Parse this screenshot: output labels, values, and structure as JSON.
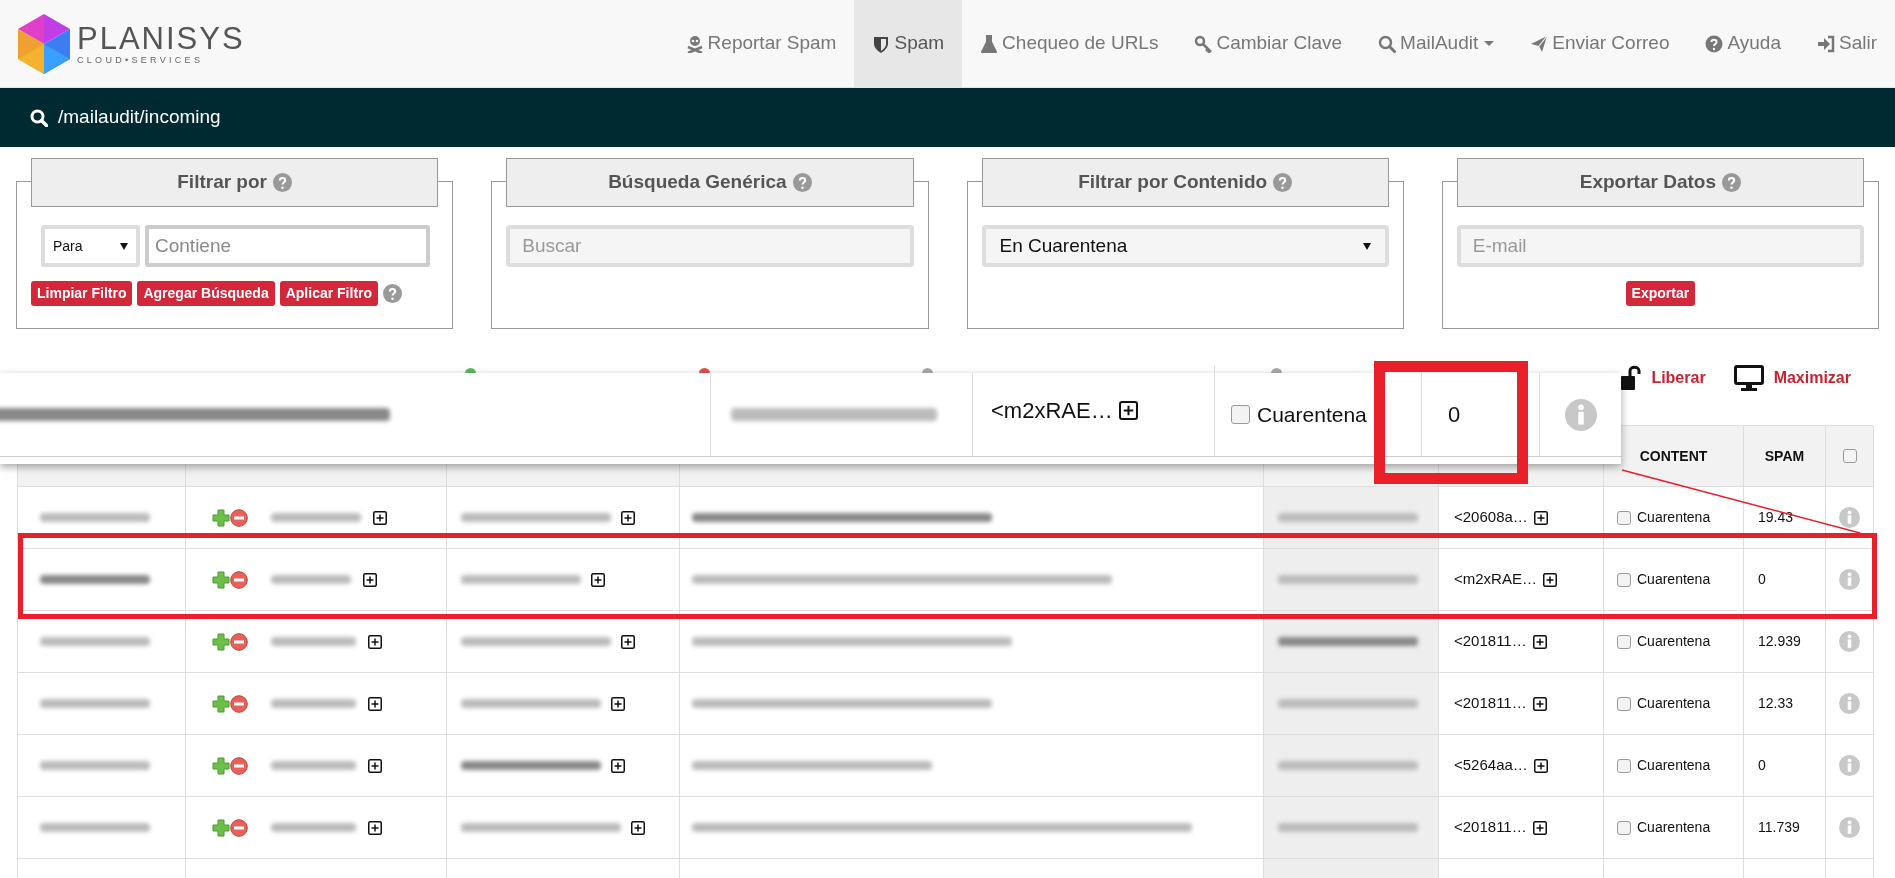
{
  "logo": {
    "name": "PLANISYS",
    "tagline": "CLOUD•SERVICES"
  },
  "nav": [
    {
      "kind": "skull",
      "label": "Reportar Spam",
      "selected": false,
      "dropdown": false
    },
    {
      "kind": "shield",
      "label": "Spam",
      "selected": true,
      "dropdown": false
    },
    {
      "kind": "flask",
      "label": "Chequeo de URLs",
      "selected": false,
      "dropdown": false
    },
    {
      "kind": "key",
      "label": "Cambiar Clave",
      "selected": false,
      "dropdown": false
    },
    {
      "kind": "search",
      "label": "MailAudit",
      "selected": false,
      "dropdown": true
    },
    {
      "kind": "send",
      "label": "Enviar Correo",
      "selected": false,
      "dropdown": false
    },
    {
      "kind": "help",
      "label": "Ayuda",
      "selected": false,
      "dropdown": false
    },
    {
      "kind": "signin",
      "label": "Salir",
      "selected": false,
      "dropdown": false
    }
  ],
  "path_bar": {
    "path": "/mailaudit/incoming"
  },
  "panels": [
    {
      "kind": "filter",
      "title": "Filtrar por",
      "field": "Para",
      "placeholder": "Contiene",
      "buttons": [
        "Limpiar Filtro",
        "Agregar Búsqueda",
        "Aplicar Filtro"
      ]
    },
    {
      "kind": "search",
      "title": "Búsqueda Genérica",
      "placeholder": "Buscar"
    },
    {
      "kind": "select",
      "title": "Filtrar por Contenido",
      "value": "En Cuarentena"
    },
    {
      "kind": "export",
      "title": "Exportar Datos",
      "placeholder": "E-mail",
      "buttons": [
        "Exportar"
      ]
    }
  ],
  "legend": [
    {
      "color": "#5cb85c"
    },
    {
      "color": "#e0504d"
    },
    {
      "color": "#aaaaaa"
    },
    {
      "color": "#aaaaaa"
    }
  ],
  "actions": [
    {
      "kind": "unlock",
      "label": "Liberar"
    },
    {
      "kind": "monitor",
      "label": "Maximizar"
    }
  ],
  "table": {
    "columns": [
      "CONTENT",
      "SPAM"
    ],
    "select_all_checked": false,
    "rows": [
      {
        "message_id": "<20608a…",
        "quarantine_label": "Cuarentena",
        "checked": false,
        "spam": "19.43"
      },
      {
        "message_id": "<m2xRAE…",
        "quarantine_label": "Cuarentena",
        "checked": false,
        "spam": "0"
      },
      {
        "message_id": "<201811…",
        "quarantine_label": "Cuarentena",
        "checked": false,
        "spam": "12.939"
      },
      {
        "message_id": "<201811…",
        "quarantine_label": "Cuarentena",
        "checked": false,
        "spam": "12.33"
      },
      {
        "message_id": "<5264aa…",
        "quarantine_label": "Cuarentena",
        "checked": false,
        "spam": "0"
      },
      {
        "message_id": "<201811…",
        "quarantine_label": "Cuarentena",
        "checked": false,
        "spam": "11.739"
      }
    ]
  },
  "zoom_popup": {
    "message_id": "<m2xRAE…",
    "quarantine_label": "Cuarentena",
    "checked": false,
    "spam": "0"
  }
}
